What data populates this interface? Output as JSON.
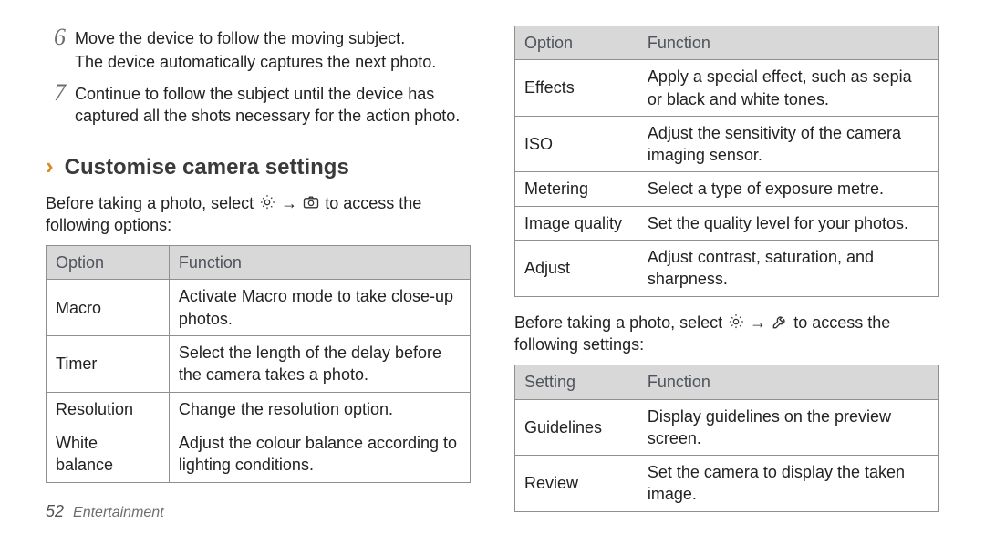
{
  "steps": [
    {
      "n": "6",
      "lines": [
        "Move the device to follow the moving subject.",
        "The device automatically captures the next photo."
      ]
    },
    {
      "n": "7",
      "lines": [
        "Continue to follow the subject until the device has captured all the shots necessary for the action photo."
      ]
    }
  ],
  "heading": "Customise camera settings",
  "para1_a": "Before taking a photo, select ",
  "para1_b": " → ",
  "para1_c": " to access the following options:",
  "table1": {
    "h1": "Option",
    "h2": "Function",
    "rows": [
      {
        "o": "Macro",
        "f": "Activate Macro mode to take close-up photos."
      },
      {
        "o": "Timer",
        "f": "Select the length of the delay before the camera takes a photo."
      },
      {
        "o": "Resolution",
        "f": "Change the resolution option."
      },
      {
        "o": "White balance",
        "f": "Adjust the colour balance according to lighting conditions."
      }
    ]
  },
  "table2": {
    "h1": "Option",
    "h2": "Function",
    "rows": [
      {
        "o": "Effects",
        "f": "Apply a special effect, such as sepia or black and white tones."
      },
      {
        "o": "ISO",
        "f": "Adjust the sensitivity of the camera imaging sensor."
      },
      {
        "o": "Metering",
        "f": "Select a type of exposure metre."
      },
      {
        "o": "Image quality",
        "f": "Set the quality level for your photos."
      },
      {
        "o": "Adjust",
        "f": "Adjust contrast, saturation, and sharpness."
      }
    ]
  },
  "para2_a": "Before taking a photo, select ",
  "para2_b": " → ",
  "para2_c": " to access the following settings:",
  "table3": {
    "h1": "Setting",
    "h2": "Function",
    "rows": [
      {
        "o": "Guidelines",
        "f": "Display guidelines on the preview screen."
      },
      {
        "o": "Review",
        "f": "Set the camera to display the taken image."
      }
    ]
  },
  "footer": {
    "page": "52",
    "section": "Entertainment"
  }
}
